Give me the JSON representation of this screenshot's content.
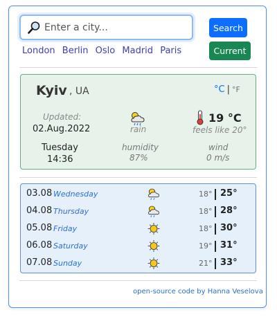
{
  "search": {
    "placeholder": "Enter a city...",
    "value": ""
  },
  "buttons": {
    "search": "Search",
    "current": "Current"
  },
  "quick_cities": [
    "London",
    "Berlin",
    "Oslo",
    "Madrid",
    "Paris"
  ],
  "current": {
    "city": "Kyiv",
    "country": ", UA",
    "unit_celsius": "°C",
    "unit_separator": "|",
    "unit_fahrenheit": "°F",
    "updated_label": "Updated:",
    "date": "02.Aug.2022",
    "day": "Tuesday",
    "time": "14:36",
    "icon": "rain-cloud-icon",
    "description": "rain",
    "humidity_label": "humidity",
    "humidity_value": "87%",
    "temperature": "19 °C",
    "feels_like": "feels like 20°",
    "wind_label": "wind",
    "wind_value": "0 m/s"
  },
  "forecast": [
    {
      "date": "03.08",
      "day": "Wednesday",
      "icon": "rain-cloud-icon",
      "min": "18°",
      "sep": "|",
      "max": "25°"
    },
    {
      "date": "04.08",
      "day": "Thursday",
      "icon": "rain-cloud-icon",
      "min": "18°",
      "sep": "|",
      "max": "28°"
    },
    {
      "date": "05.08",
      "day": "Friday",
      "icon": "sun-icon",
      "min": "18°",
      "sep": "|",
      "max": "30°"
    },
    {
      "date": "06.08",
      "day": "Saturday",
      "icon": "sun-icon",
      "min": "19°",
      "sep": "|",
      "max": "31°"
    },
    {
      "date": "07.08",
      "day": "Sunday",
      "icon": "sun-icon",
      "min": "21°",
      "sep": "|",
      "max": "33°"
    }
  ],
  "footer": "open-source code by Hanna Veselova",
  "colors": {
    "primary": "#0d6efd",
    "success": "#198754",
    "current_bg": "#e7f3ea",
    "current_border": "#62b179",
    "forecast_bg": "#e6f0fb",
    "forecast_border": "#5c8fdf",
    "link": "#3d3db5"
  }
}
